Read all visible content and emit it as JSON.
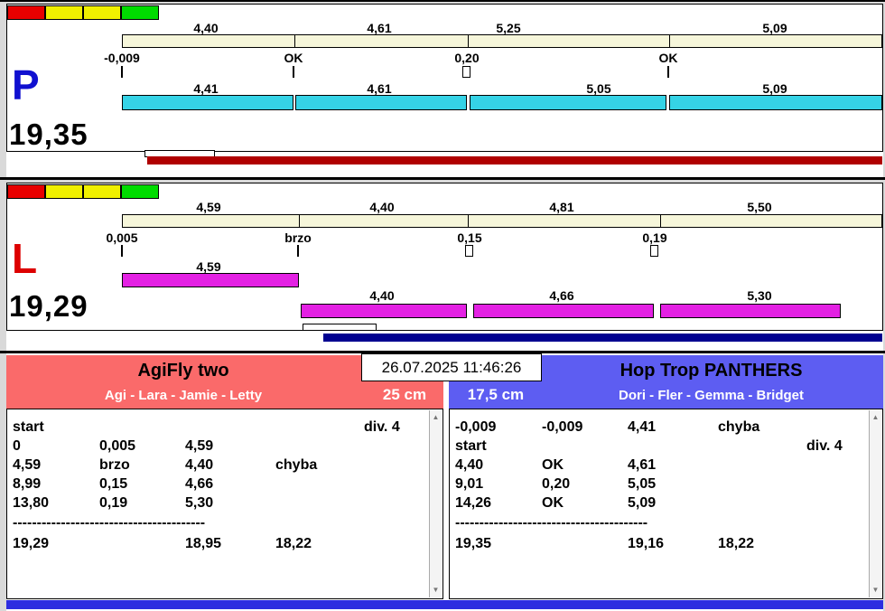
{
  "header": {
    "datetime": "26.07.2025 11:46:26"
  },
  "icons": {
    "scroll_up": "▲",
    "scroll_down": "▼"
  },
  "colors": {
    "lights": [
      "#e80000",
      "#f0f000",
      "#f0f000",
      "#00dc00"
    ],
    "plan_bar": "#f6f6da",
    "lane_p_bar": "#35d3e6",
    "lane_l_bar": "#e321e3",
    "lane_p_progress": "#b00000",
    "lane_l_progress": "#000090",
    "lane_p_letter": "#1010d0",
    "lane_l_letter": "#dd0000",
    "team_left_bg": "#fa6a6a",
    "team_right_bg": "#5d5df2",
    "bottom_bar": "#2d2de0"
  },
  "lane_p": {
    "letter": "P",
    "total": "19,35",
    "plan_splits": [
      "4,40",
      "4,61",
      "5,25",
      "5,09"
    ],
    "change_marks": [
      "-0,009",
      "OK",
      "0,20",
      "OK"
    ],
    "run_splits": [
      "4,41",
      "4,61",
      "5,05",
      "5,09"
    ]
  },
  "lane_l": {
    "letter": "L",
    "total": "19,29",
    "plan_splits": [
      "4,59",
      "4,40",
      "4,81",
      "5,50"
    ],
    "change_marks": [
      "0,005",
      "brzo",
      "0,15",
      "0,19"
    ],
    "rerun_split": "4,59",
    "run_splits": [
      "4,40",
      "4,66",
      "5,30"
    ]
  },
  "team_left": {
    "name": "AgiFly two",
    "members": "Agi - Lara - Jamie - Letty",
    "jump_height": "25 cm",
    "log": [
      [
        "start",
        "",
        "",
        "",
        "div. 4"
      ],
      [
        "0",
        "0,005",
        "4,59",
        "",
        ""
      ],
      [
        "4,59",
        "brzo",
        "4,40",
        "chyba",
        ""
      ],
      [
        "8,99",
        "0,15",
        "4,66",
        "",
        ""
      ],
      [
        "13,80",
        "0,19",
        "5,30",
        "",
        ""
      ],
      [
        "----------------------------------------",
        "",
        "",
        "",
        ""
      ],
      [
        "19,29",
        "",
        "18,95",
        "18,22",
        ""
      ]
    ]
  },
  "team_right": {
    "name": "Hop Trop PANTHERS",
    "members": "Dori - Fler - Gemma - Bridget",
    "jump_height": "17,5 cm",
    "log": [
      [
        "-0,009",
        "-0,009",
        "4,41",
        "chyba",
        ""
      ],
      [
        "start",
        "",
        "",
        "",
        "div. 4"
      ],
      [
        "4,40",
        "OK",
        "4,61",
        "",
        ""
      ],
      [
        "9,01",
        "0,20",
        "5,05",
        "",
        ""
      ],
      [
        "14,26",
        "OK",
        "5,09",
        "",
        ""
      ],
      [
        "----------------------------------------",
        "",
        "",
        "",
        ""
      ],
      [
        "19,35",
        "",
        "19,16",
        "18,22",
        ""
      ]
    ]
  }
}
